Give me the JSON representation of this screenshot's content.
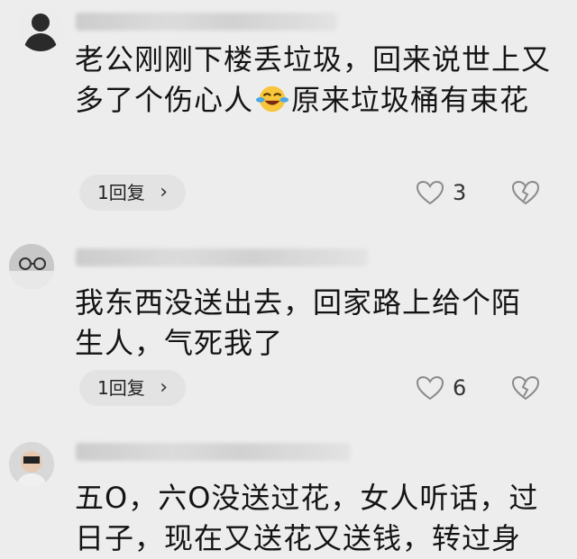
{
  "comments": [
    {
      "text": "老公刚刚下楼丢垃圾，回来说世上又多了个伤心人",
      "emoji": "laughing-crying-emoji",
      "text_after": "原来垃圾桶有束花",
      "reply_label": "1回复",
      "likes": "3"
    },
    {
      "text": "我东西没送出去，回家路上给个陌生人，气死我了",
      "reply_label": "1回复",
      "likes": "6"
    },
    {
      "text": "五O，六O没送过花，女人听话，过日子，现在又送花又送钱，转过身"
    }
  ],
  "icons": {
    "like": "heart-outline-icon",
    "dislike": "broken-heart-icon",
    "chevron": "chevron-right-icon"
  },
  "colors": {
    "background": "#ededed",
    "pill": "#e3e3e3",
    "icon": "#8a8a8a"
  }
}
